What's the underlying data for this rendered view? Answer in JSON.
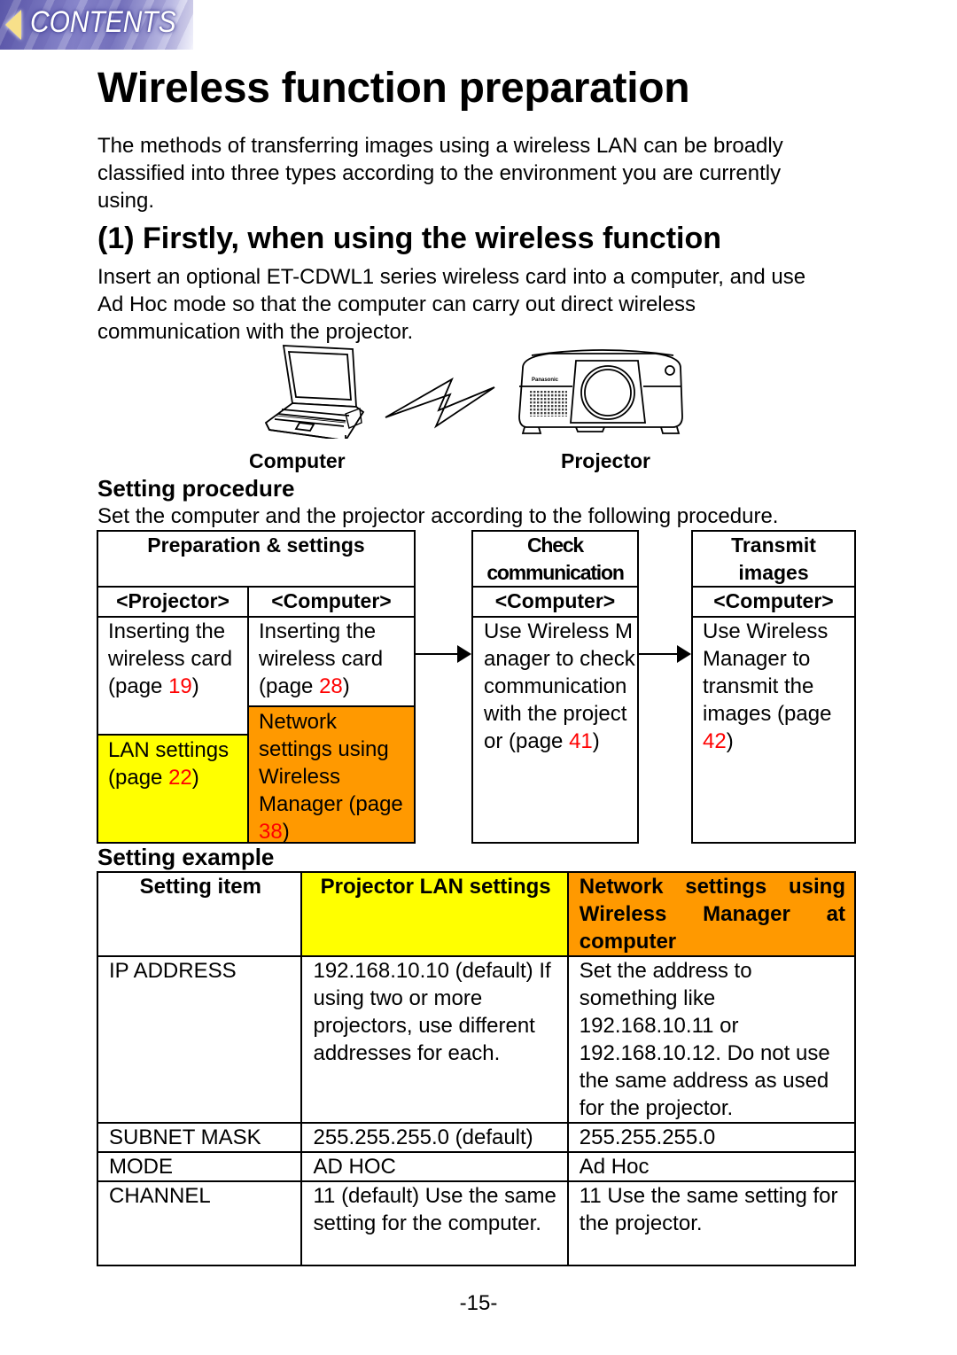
{
  "nav": {
    "contents_label": "CONTENTS"
  },
  "title": "Wireless function preparation",
  "intro": "The methods of transferring images using a wireless LAN can be broadly classified into three types according to the environment you are currently using.",
  "section1": {
    "heading": "(1) Firstly, when using the wireless function",
    "text": "Insert an optional ET-CDWL1 series wireless card into a computer, and use Ad Hoc mode so that the computer can carry out direct wireless communication with the projector.",
    "illustration": {
      "computer_label": "Computer",
      "projector_label": "Projector",
      "projector_brand": "Panasonic"
    }
  },
  "procedure": {
    "heading": "Setting procedure",
    "text": "Set the computer and the projector according to the following procedure.",
    "step1": {
      "title": "Preparation & settings",
      "projector_header": "<Projector>",
      "computer_header": "<Computer>",
      "projector_insert": {
        "text": "Inserting the wireless card (page ",
        "page": "19",
        "end": ")"
      },
      "projector_lan": {
        "text": "LAN settings (page ",
        "page": "22",
        "end": ")"
      },
      "computer_insert": {
        "text": "Inserting the wireless card (page ",
        "page": "28",
        "end": ")"
      },
      "computer_network": {
        "text": "Network settings using Wireless Manager (page ",
        "page": "38",
        "end": ")"
      }
    },
    "step2": {
      "title": "Check communication",
      "header": "<Computer>",
      "body": {
        "text": "Use Wireless Manager to check communication with the projector (page ",
        "page": "41",
        "end": ")"
      }
    },
    "step3": {
      "title": "Transmit images",
      "header": "<Computer>",
      "body": {
        "text": "Use Wireless Manager to transmit the images (page ",
        "page": "42",
        "end": ")"
      }
    }
  },
  "example": {
    "heading": "Setting example",
    "headers": [
      "Setting item",
      "Projector LAN settings",
      "Network settings using Wireless Manager at computer"
    ],
    "rows": [
      [
        "IP ADDRESS",
        "192.168.10.10 (default) If using two or more projectors, use different addresses for each.",
        "Set the address to something like 192.168.10.11 or 192.168.10.12. Do not use the same address as used for the projector."
      ],
      [
        "SUBNET MASK",
        "255.255.255.0 (default)",
        "255.255.255.0"
      ],
      [
        "MODE",
        "AD HOC",
        "Ad Hoc"
      ],
      [
        "CHANNEL",
        "11 (default) Use the same setting for the computer.",
        "11 Use the same setting for the projector."
      ]
    ]
  },
  "colors": {
    "highlight_yellow": "#ffff00",
    "highlight_orange": "#ff9900",
    "page_ref_red": "#ff0000"
  },
  "page_number": "-15-"
}
